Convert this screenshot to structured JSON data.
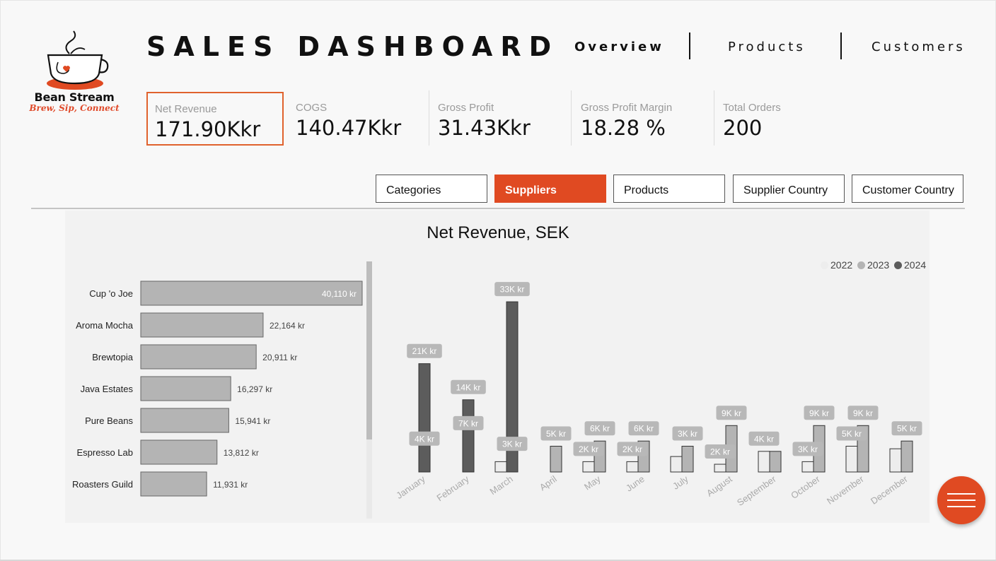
{
  "brand": {
    "name": "Bean Stream",
    "tagline": "Brew, Sip, Connect"
  },
  "title": "SALES DASHBOARD",
  "nav": [
    "Overview",
    "Products",
    "Customers"
  ],
  "kpis": [
    {
      "label": "Net Revenue",
      "value": "171.90Kkr"
    },
    {
      "label": "COGS",
      "value": "140.47Kkr"
    },
    {
      "label": "Gross Profit",
      "value": "31.43Kkr"
    },
    {
      "label": "Gross Profit Margin",
      "value": "18.28 %"
    },
    {
      "label": "Total Orders",
      "value": "200"
    }
  ],
  "tabs": [
    "Categories",
    "Suppliers",
    "Products",
    "Supplier Country",
    "Customer Country"
  ],
  "colors": {
    "accent": "#e04a22",
    "kpi_border": "#e0622d",
    "bar": "#b4b4b4",
    "y2022": "#ededed",
    "y2023": "#b4b4b4",
    "y2024": "#5c5c5c"
  },
  "chart_data": [
    {
      "type": "bar",
      "orientation": "horizontal",
      "title": "Net Revenue, SEK",
      "categories": [
        "Cup 'o Joe",
        "Aroma Mocha",
        "Brewtopia",
        "Java Estates",
        "Pure Beans",
        "Espresso Lab",
        "Roasters Guild"
      ],
      "values": [
        40110,
        22164,
        20911,
        16297,
        15941,
        13812,
        11931
      ],
      "labels": [
        "40,110 kr",
        "22,164 kr",
        "20,911 kr",
        "16,297 kr",
        "15,941 kr",
        "13,812 kr",
        "11,931 kr"
      ]
    },
    {
      "type": "bar",
      "orientation": "vertical",
      "categories": [
        "January",
        "February",
        "March",
        "April",
        "May",
        "June",
        "July",
        "August",
        "September",
        "October",
        "November",
        "December"
      ],
      "legend": [
        "2022",
        "2023",
        "2024"
      ],
      "legend_position": "top-right",
      "series": [
        {
          "name": "2022",
          "values": [
            0,
            0,
            2,
            0,
            2,
            2,
            3,
            1.5,
            4,
            2,
            5,
            4.5
          ]
        },
        {
          "name": "2023",
          "values": [
            4,
            7,
            3,
            5,
            6,
            6,
            5,
            9,
            4,
            9,
            9,
            6
          ]
        },
        {
          "name": "2024",
          "values": [
            21,
            14,
            33,
            0,
            0,
            0,
            0,
            0,
            0,
            0,
            0,
            0
          ]
        }
      ],
      "data_labels": [
        [
          "21K kr",
          "4K kr"
        ],
        [
          "14K kr",
          "7K kr"
        ],
        [
          "33K kr",
          "3K kr"
        ],
        [
          "5K kr"
        ],
        [
          "6K kr",
          "2K kr"
        ],
        [
          "6K kr",
          "2K kr"
        ],
        [
          "3K kr"
        ],
        [
          "9K kr",
          "2K kr"
        ],
        [
          "4K kr"
        ],
        [
          "9K kr",
          "3K kr"
        ],
        [
          "9K kr",
          "5K kr"
        ],
        [
          "5K kr"
        ]
      ]
    }
  ]
}
